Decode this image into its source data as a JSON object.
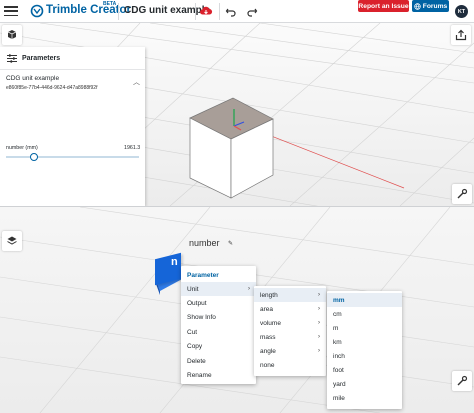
{
  "topbar": {
    "brand": "Trimble Creator",
    "beta": "BETA",
    "document_title": "CDG unit example",
    "report_label": "Report an Issue",
    "forums_label": "Forums",
    "avatar_initials": "KT"
  },
  "panel": {
    "title": "Parameters",
    "name": "CDG unit example",
    "id": "e860f85e-77b4-446d-9624-d47a8988f92f",
    "param_label": "number (mm)",
    "param_value": "1961.3",
    "slider_fraction": 0.2
  },
  "node": {
    "label": "number",
    "glyph": "n"
  },
  "context_menu": {
    "items": [
      "Parameter",
      "Unit",
      "Output",
      "Show Info",
      "Cut",
      "Copy",
      "Delete",
      "Rename"
    ]
  },
  "unit_menu": {
    "items": [
      "length",
      "area",
      "volume",
      "mass",
      "angle",
      "none"
    ]
  },
  "length_menu": {
    "items": [
      "mm",
      "cm",
      "m",
      "km",
      "inch",
      "foot",
      "yard",
      "mile"
    ],
    "selected": "mm"
  },
  "colors": {
    "brand_blue": "#0063a3",
    "report_red": "#da212c",
    "node_blue": "#1565d8"
  }
}
